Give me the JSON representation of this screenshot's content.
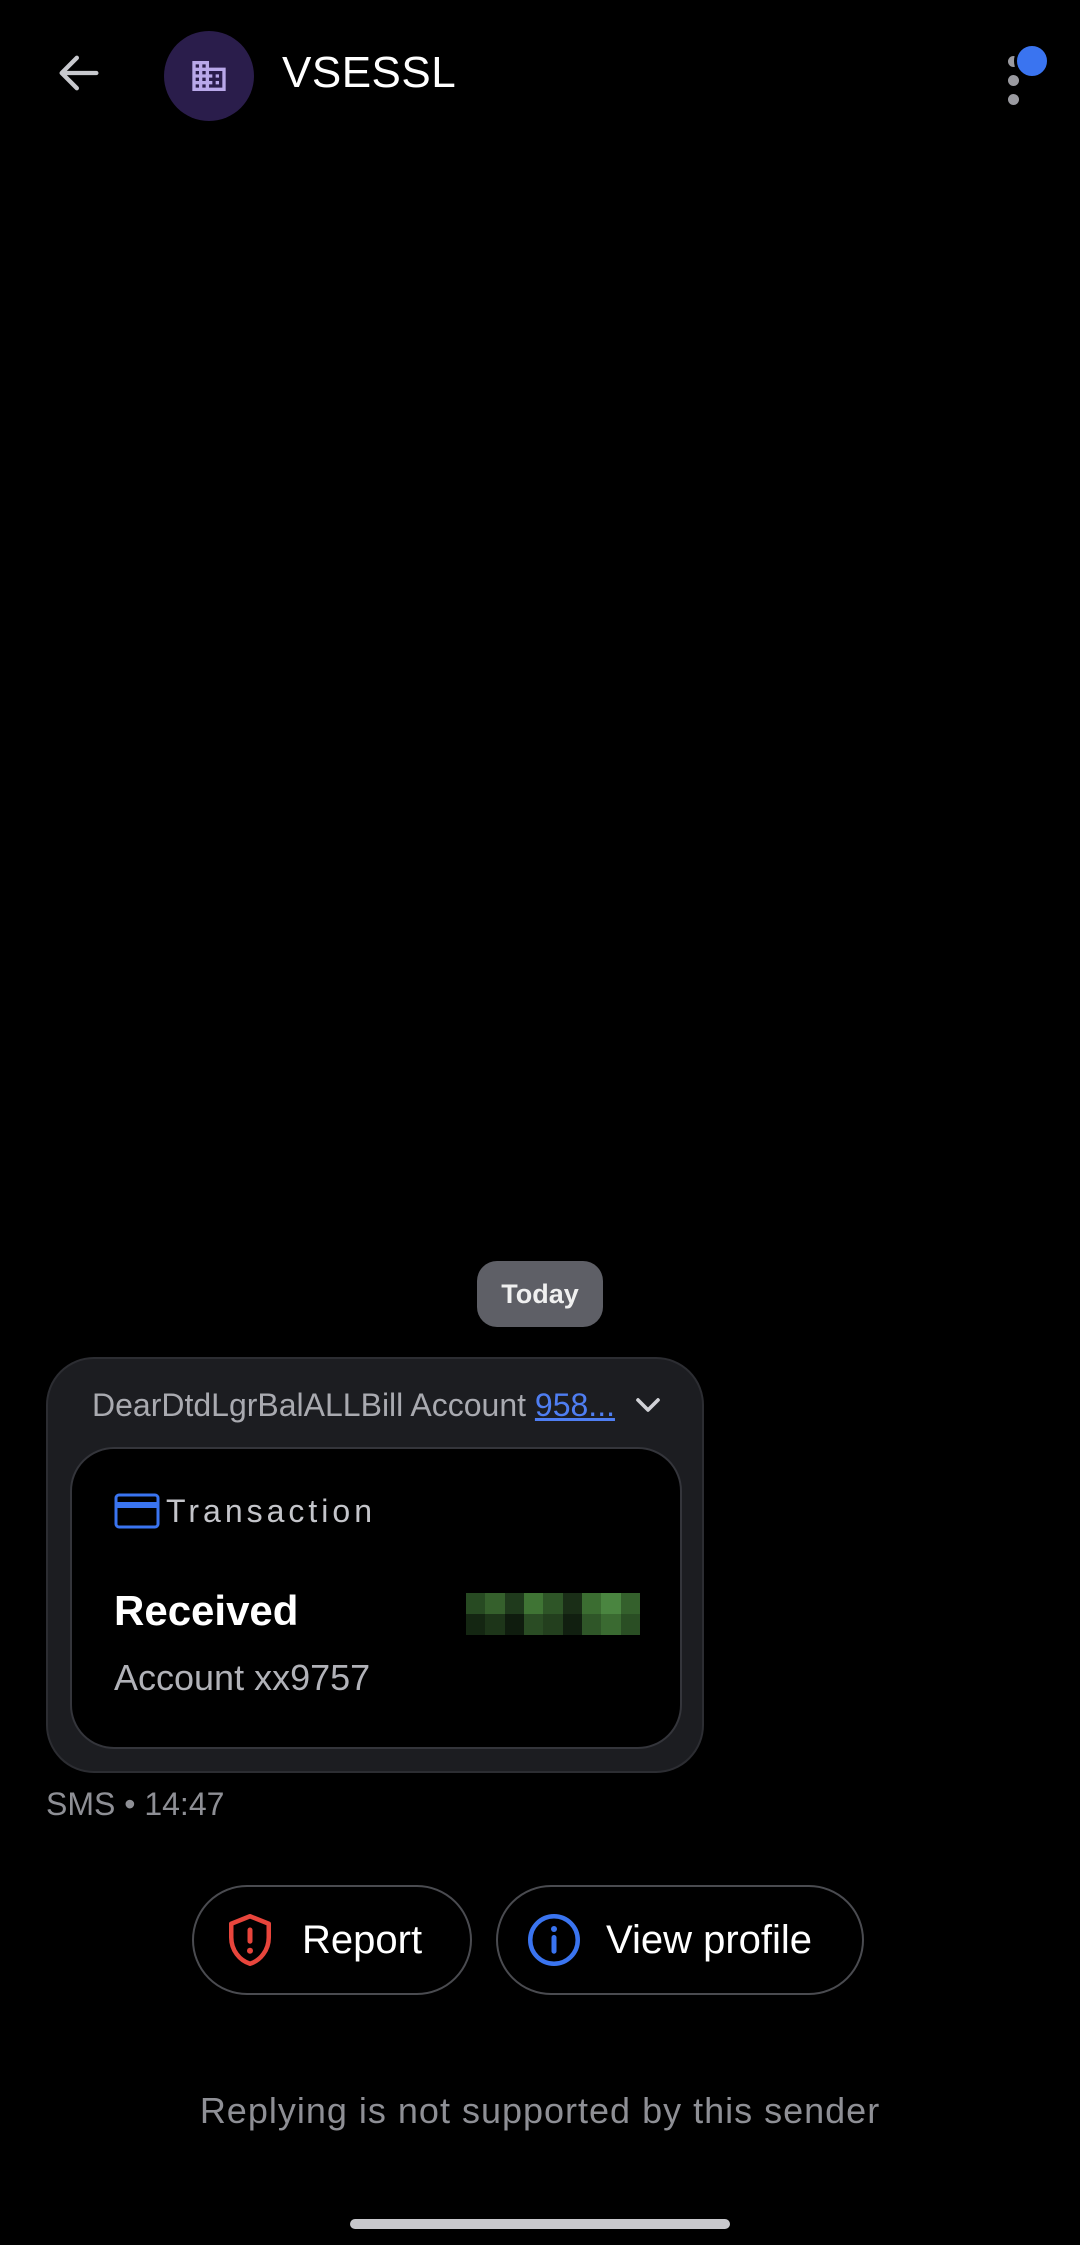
{
  "header": {
    "sender_name": "VSESSL",
    "back_icon": "arrow-left-icon",
    "avatar_icon": "building-icon",
    "menu_icon": "more-vertical-icon",
    "notification_dot_color": "#3a74f0"
  },
  "conversation": {
    "date_label": "Today",
    "message": {
      "snippet_text": "DearDtdLgrBalALLBill Account ",
      "snippet_link": "958...",
      "card": {
        "title": "Transaction",
        "status": "Received",
        "account": "Account xx9757",
        "amount_redacted": true
      },
      "meta": "SMS • 14:47"
    }
  },
  "actions": {
    "report_label": "Report",
    "view_profile_label": "View profile"
  },
  "footer": {
    "reply_note": "Replying is not supported by this sender"
  },
  "colors": {
    "background": "#000000",
    "accent": "#3a74f0",
    "report_red": "#e8453c",
    "link_blue": "#4f7ef2"
  }
}
